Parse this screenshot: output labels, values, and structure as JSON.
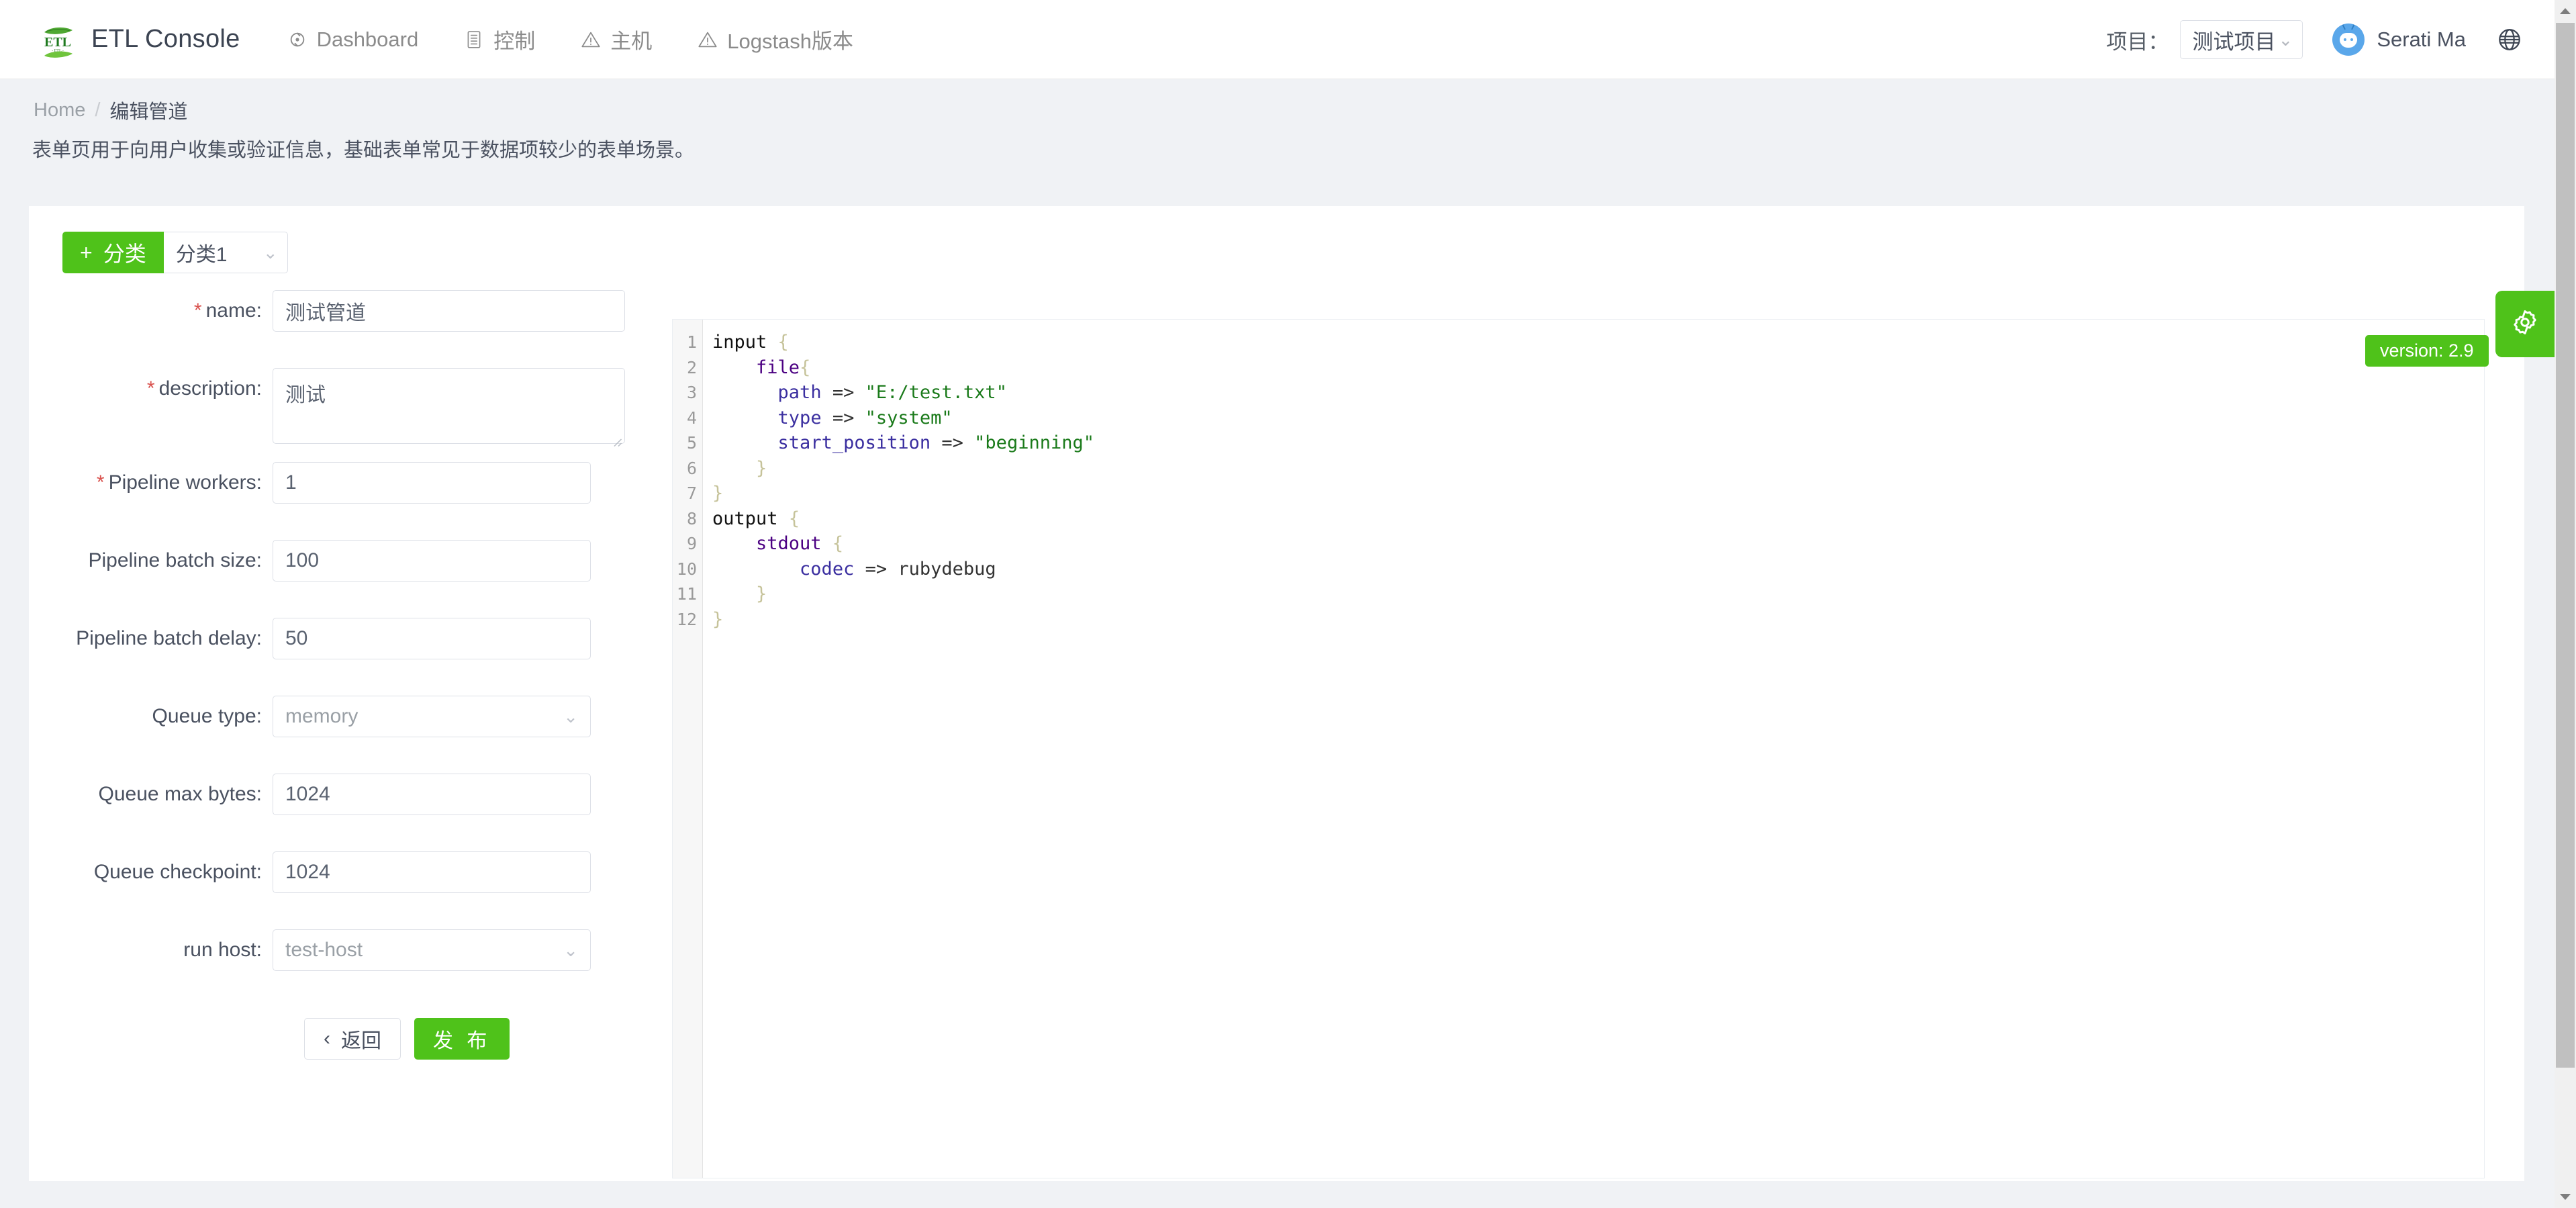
{
  "header": {
    "brand_title": "ETL Console",
    "logo_alt": "ETL",
    "nav": [
      {
        "label": "Dashboard",
        "icon": "dashboard-icon"
      },
      {
        "label": "控制",
        "icon": "control-icon"
      },
      {
        "label": "主机",
        "icon": "host-warning-icon"
      },
      {
        "label": "Logstash版本",
        "icon": "version-warning-icon"
      }
    ],
    "project_label": "项目：",
    "project_value": "测试项目",
    "username": "Serati Ma",
    "globe_icon": "globe-icon"
  },
  "breadcrumb": {
    "home": "Home",
    "separator": "/",
    "current": "编辑管道"
  },
  "page_description": "表单页用于向用户收集或验证信息，基础表单常见于数据项较少的表单场景。",
  "category": {
    "add_button_label": "分类",
    "add_button_icon": "plus-icon",
    "selected": "分类1"
  },
  "form": {
    "fields": [
      {
        "label": "name:",
        "required": true,
        "value": "测试管道",
        "type": "text"
      },
      {
        "label": "description:",
        "required": true,
        "value": "测试",
        "type": "textarea"
      },
      {
        "label": "Pipeline workers:",
        "required": true,
        "value": "1",
        "type": "text"
      },
      {
        "label": "Pipeline batch size:",
        "required": false,
        "value": "100",
        "type": "text"
      },
      {
        "label": "Pipeline batch delay:",
        "required": false,
        "value": "50",
        "type": "text"
      },
      {
        "label": "Queue type:",
        "required": false,
        "value": "memory",
        "type": "select"
      },
      {
        "label": "Queue max bytes:",
        "required": false,
        "value": "1024",
        "type": "text"
      },
      {
        "label": "Queue checkpoint:",
        "required": false,
        "value": "1024",
        "type": "text"
      },
      {
        "label": "run host:",
        "required": false,
        "value": "test-host",
        "type": "select"
      }
    ],
    "back_button_label": "返回",
    "back_button_icon": "chevron-left-icon",
    "publish_button_label": "发 布"
  },
  "editor": {
    "line_numbers": [
      "1",
      "2",
      "3",
      "4",
      "5",
      "6",
      "7",
      "8",
      "9",
      "10",
      "11",
      "12"
    ],
    "lines": [
      "input {",
      "    file{",
      "      path => \"E:/test.txt\"",
      "      type => \"system\"",
      "      start_position => \"beginning\"",
      "    }",
      "}",
      "output {",
      "    stdout {",
      "        codec => rubydebug",
      "    }",
      "}"
    ]
  },
  "version_badge": "version: 2.9",
  "settings_button_icon": "gear-icon",
  "colors": {
    "brand_green": "#4fc21a",
    "required_red": "#d9534f",
    "text_primary": "#4a5160",
    "text_muted": "#9aa0a6",
    "page_bg": "#f0f2f5",
    "border": "#dcdfe6"
  },
  "scrollbar": {
    "up_arrow_icon": "triangle-up-icon",
    "down_arrow_icon": "triangle-down-icon"
  }
}
